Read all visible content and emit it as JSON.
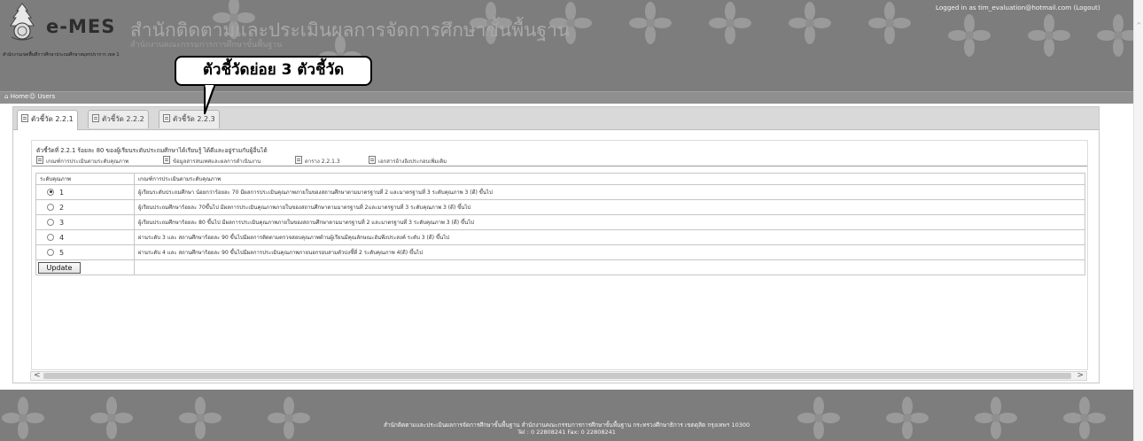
{
  "header": {
    "brand": "e-MES",
    "office_name": "สำนักติดตามและประเมินผลการจัดการศึกษาขั้นพื้นฐาน",
    "office_sub": "สำนักงานคณะกรรมการการศึกษาขั้นพื้นฐาน",
    "area_name": "สำนักงานเขตพื้นที่การศึกษาประถมศึกษาสมุทรปราการ เขต 1",
    "login_text": "Logged in as tim_evaluation@hotmail.com",
    "logout_label": "(Logout)"
  },
  "annotation": {
    "text": "ตัวชี้วัดย่อย 3 ตัวชี้วัด"
  },
  "nav": {
    "items": [
      {
        "label": "Home",
        "icon": "home-icon"
      },
      {
        "label": "Users",
        "icon": "users-icon"
      }
    ]
  },
  "tabs": [
    {
      "label": "ตัวชี้วัด 2.2.1",
      "active": true
    },
    {
      "label": "ตัวชี้วัด 2.2.2",
      "active": false
    },
    {
      "label": "ตัวชี้วัด 2.2.3",
      "active": false
    }
  ],
  "indicator": {
    "title": "ตัวชี้วัดที่ 2.2.1 ร้อยละ 80 ของผู้เรียนระดับประถมศึกษาได้เรียนรู้ ได้ดีและอยู่ร่วมกับผู้อื่นได้"
  },
  "subtabs": [
    {
      "label": "เกณฑ์การประเมินตามระดับคุณภาพ"
    },
    {
      "label": "ข้อมูลสารสนเทศและผลการดำเนินงาน"
    },
    {
      "label": "ตาราง 2.2.1.3"
    },
    {
      "label": "เอกสารอ้างอิงประกอบเพิ่มเติม"
    }
  ],
  "criteria_table": {
    "headers": [
      "ระดับคุณภาพ",
      "เกณฑ์การประเมินตามระดับคุณภาพ"
    ],
    "rows": [
      {
        "level": "1",
        "selected": true,
        "text": "ผู้เรียนระดับประถมศึกษา น้อยกว่าร้อยละ 70 มีผลการประเมินคุณภาพภายในของสถานศึกษาตามมาตรฐานที่ 2 และมาตรฐานที่ 3 ระดับคุณภาพ 3 (ดี) ขึ้นไป"
      },
      {
        "level": "2",
        "selected": false,
        "text": "ผู้เรียนประถมศึกษาร้อยละ 70ขึ้นไป มีผลการประเมินคุณภาพภายในของสถานศึกษาตามมาตรฐานที่ 2และมาตรฐานที่ 3 ระดับคุณภาพ 3 (ดี) ขึ้นไป"
      },
      {
        "level": "3",
        "selected": false,
        "text": "ผู้เรียนประถมศึกษาร้อยละ 80 ขึ้นไป มีผลการประเมินคุณภาพภายในของสถานศึกษาตามมาตรฐานที่ 2 และมาตรฐานที่ 3 ระดับคุณภาพ 3 (ดี) ขึ้นไป"
      },
      {
        "level": "4",
        "selected": false,
        "text": "ผ่านระดับ 3 และ สถานศึกษาร้อยละ 90 ขึ้นไปมีผลการติดตามตรวจสอบคุณภาพด้านผู้เรียนมีคุณลักษณะอันพึงประสงค์ ระดับ 3 (ดี) ขึ้นไป"
      },
      {
        "level": "5",
        "selected": false,
        "text": "ผ่านระดับ 4 และ สถานศึกษาร้อยละ 90 ขึ้นไปมีผลการประเมินคุณภาพภายนอกรอบสามตัวบ่งชี้ที่ 2 ระดับคุณภาพ 4(ดี) ขึ้นไป"
      }
    ],
    "update_label": "Update"
  },
  "footer": {
    "line1": "สำนักติดตามและประเมินผลการจัดการศึกษาขั้นพื้นฐาน สำนักงานคณะกรรมการการศึกษาขั้นพื้นฐาน กระทรวงศึกษาธิการ เขตดุสิต กรุงเทพฯ 10300",
    "line2": "Tel : 0 22808241 Fax: 0 22808241"
  }
}
